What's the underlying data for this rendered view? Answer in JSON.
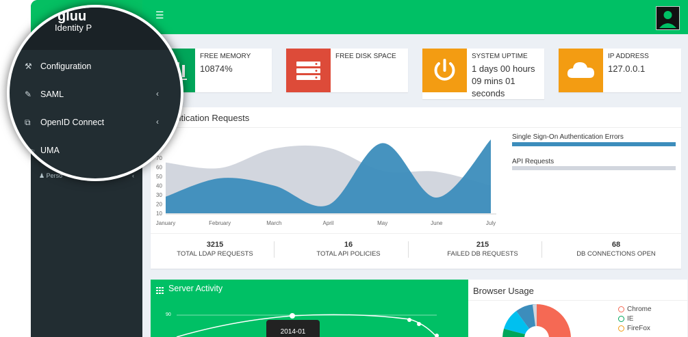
{
  "brand": {
    "logo_text": "gluu",
    "subtitle": "Identity P"
  },
  "topbar": {
    "menu_icon": "☰"
  },
  "sidebar_partial": {
    "item_label_partial": "Perso",
    "item_label_partial2": "s"
  },
  "magnifier_menu": [
    {
      "label": "Configuration",
      "icon": "wrench-icon",
      "has_chevron": false
    },
    {
      "label": "SAML",
      "icon": "edit-icon",
      "has_chevron": true
    },
    {
      "label": "OpenID Connect",
      "icon": "external-link-icon",
      "has_chevron": true
    },
    {
      "label": "UMA",
      "icon": "folder-open-icon",
      "has_chevron": false
    }
  ],
  "info_boxes": [
    {
      "label": "FREE MEMORY",
      "value": "10874%",
      "color": "#00a65a",
      "icon": "bar-chart-icon"
    },
    {
      "label": "FREE DISK SPACE",
      "value": "",
      "color": "#dd4b39",
      "icon": "server-icon"
    },
    {
      "label": "SYSTEM UPTIME",
      "value": "1 days 00 hours 09 mins 01 seconds",
      "color": "#f39c12",
      "icon": "power-icon"
    },
    {
      "label": "IP ADDRESS",
      "value": "127.0.0.1",
      "color": "#f39c12",
      "icon": "cloud-icon"
    }
  ],
  "auth_panel": {
    "title": "Authentication Requests",
    "title_visible": "uthentication Requests"
  },
  "chart_data": {
    "type": "area",
    "title": "Authentication Requests",
    "x": [
      "January",
      "February",
      "March",
      "April",
      "May",
      "June",
      "July"
    ],
    "ylim": [
      10,
      90
    ],
    "yticks": [
      10,
      20,
      30,
      40,
      50,
      60,
      70,
      80,
      90
    ],
    "series": [
      {
        "name": "Single Sign-On Authentication Errors",
        "color": "#3c8dbc",
        "values": [
          28,
          48,
          40,
          19,
          86,
          27,
          90
        ]
      },
      {
        "name": "API Requests",
        "color": "#d2d6de",
        "values": [
          65,
          59,
          80,
          81,
          56,
          55,
          40
        ]
      }
    ]
  },
  "stats": [
    {
      "value": "3215",
      "label": "TOTAL LDAP REQUESTS"
    },
    {
      "value": "16",
      "label": "TOTAL API POLICIES"
    },
    {
      "value": "215",
      "label": "FAILED DB REQUESTS"
    },
    {
      "value": "68",
      "label": "DB CONNECTIONS OPEN"
    }
  ],
  "server_activity": {
    "title": "Server Activity",
    "y_tick": "90",
    "tooltip": "2014-01"
  },
  "browser_usage": {
    "title": "Browser Usage",
    "legend": [
      {
        "name": "Chrome",
        "color": "#f56954"
      },
      {
        "name": "IE",
        "color": "#00a65a"
      },
      {
        "name": "FireFox",
        "color": "#f39c12"
      }
    ]
  }
}
